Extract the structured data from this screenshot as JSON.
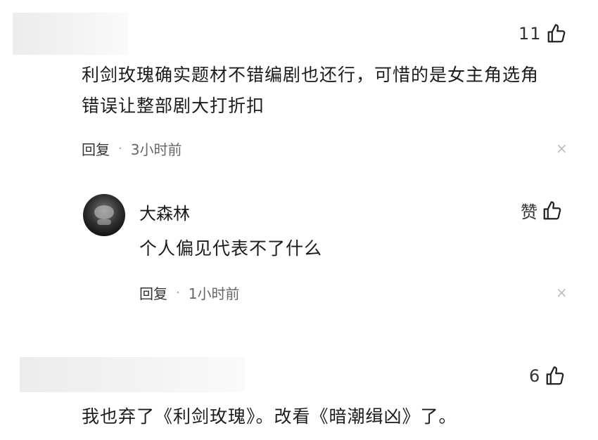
{
  "comments": [
    {
      "like_count": "11",
      "text_line1": "利剑玫瑰确实题材不错编剧也还行，可惜的是女主角选角",
      "text_line2": "错误让整部剧大打折扣",
      "reply_label": "回复",
      "separator": "·",
      "time": "3小时前",
      "close_glyph": "×",
      "reply": {
        "username": "大森林",
        "like_label": "赞",
        "text": "个人偏见代表不了什么",
        "reply_label": "回复",
        "separator": "·",
        "time": "1小时前",
        "close_glyph": "×"
      }
    },
    {
      "like_count": "6",
      "text": "我也弃了《利剑玫瑰》。改看《暗潮缉凶》了。"
    }
  ],
  "icons": {
    "like": "thumbs-up-outline",
    "close": "close-x",
    "avatar": "user-avatar"
  },
  "colors": {
    "text": "#1c1c1c",
    "meta": "#666666",
    "close": "#bdbdbd",
    "blur": "#ececec"
  }
}
